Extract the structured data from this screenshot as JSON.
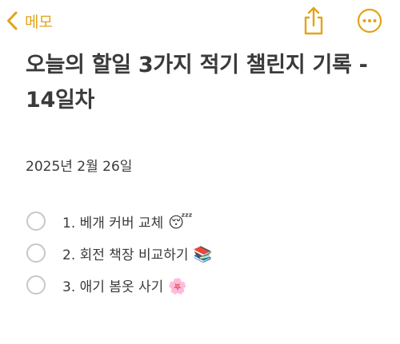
{
  "colors": {
    "accent": "#e3a318",
    "text": "#3a3a3c",
    "checkbox_border": "#c7c7cc"
  },
  "header": {
    "back_label": "메모",
    "back_icon": "chevron-left-icon",
    "share_icon": "share-icon",
    "more_icon": "ellipsis-circle-icon"
  },
  "note": {
    "title": "오늘의 할일 3가지 적기 챌린지 기록 - 14일차",
    "date": "2025년 2월 26일",
    "checklist": [
      {
        "text": "1. 베개 커버 교체",
        "emoji": "😴",
        "checked": false
      },
      {
        "text": "2. 회전 책장 비교하기",
        "emoji": "📚",
        "checked": false
      },
      {
        "text": "3. 애기 봄옷 사기",
        "emoji": "🌸",
        "checked": false
      }
    ]
  }
}
